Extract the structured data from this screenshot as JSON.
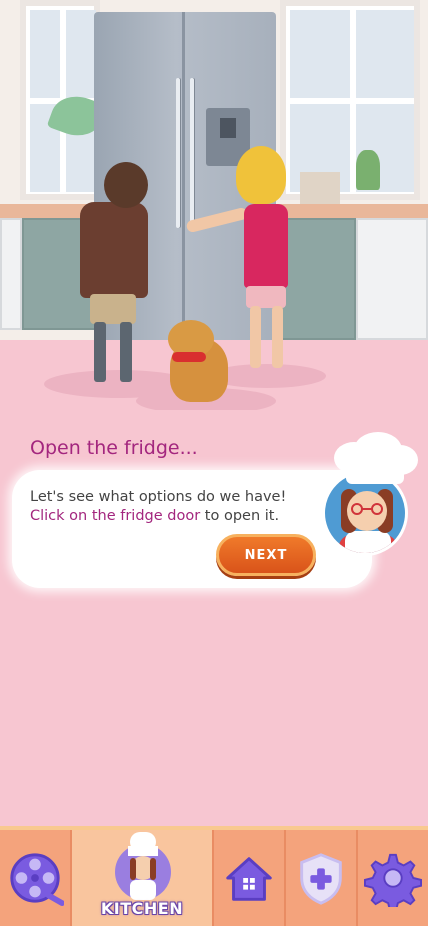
{
  "dialog": {
    "title": "Open the fridge...",
    "message_line1": "Let's see what options do we have!",
    "message_link": "Click on the fridge door",
    "message_tail": " to open it.",
    "next_label": "NEXT"
  },
  "nav": {
    "items": [
      {
        "id": "videos",
        "icon": "film-reel-icon",
        "label": ""
      },
      {
        "id": "kitchen",
        "icon": "chef-avatar",
        "label": "KITCHEN",
        "active": true
      },
      {
        "id": "home",
        "icon": "home-icon",
        "label": ""
      },
      {
        "id": "safety",
        "icon": "shield-plus-icon",
        "label": ""
      },
      {
        "id": "settings",
        "icon": "gear-icon",
        "label": ""
      }
    ]
  },
  "colors": {
    "background": "#f7c6d1",
    "title": "#a3267e",
    "link": "#a3267e",
    "button": "#e0621f",
    "nav": "#f4a37c",
    "icon": "#7a5be0"
  }
}
